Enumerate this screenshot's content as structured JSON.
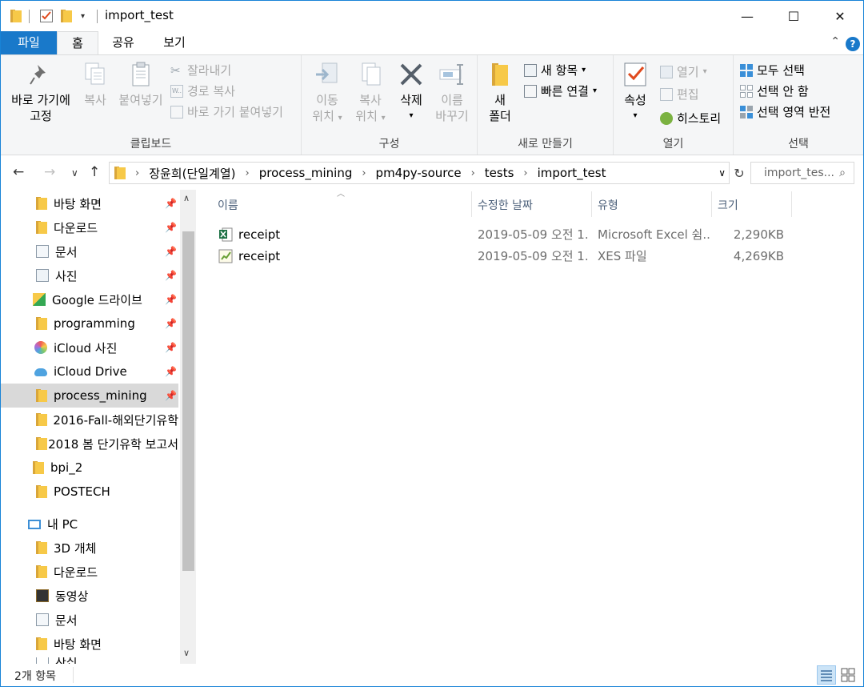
{
  "window": {
    "title": "import_test",
    "minimize": "—",
    "maximize": "☐",
    "close": "✕"
  },
  "ribbon_tabs": [
    "파일",
    "홈",
    "공유",
    "보기"
  ],
  "help_label": "?",
  "clipboard": {
    "pin_label_1": "바로 가기에",
    "pin_label_2": "고정",
    "copy": "복사",
    "paste": "붙여넣기",
    "cut": "잘라내기",
    "copy_path": "경로 복사",
    "paste_shortcut": "바로 가기 붙여넣기",
    "group": "클립보드"
  },
  "organize": {
    "move_1": "이동",
    "move_2": "위치",
    "copy_1": "복사",
    "copy_2": "위치",
    "delete": "삭제",
    "rename_1": "이름",
    "rename_2": "바꾸기",
    "group": "구성"
  },
  "new": {
    "folder_1": "새",
    "folder_2": "폴더",
    "new_item": "새 항목",
    "easy_access": "빠른 연결",
    "group": "새로 만들기"
  },
  "open": {
    "properties": "속성",
    "open": "열기",
    "edit": "편집",
    "history": "히스토리",
    "group": "열기"
  },
  "select": {
    "all": "모두 선택",
    "none": "선택 안 함",
    "invert": "선택 영역 반전",
    "group": "선택"
  },
  "address": {
    "crumbs": [
      "장윤희(단일계열)",
      "process_mining",
      "pm4py-source",
      "tests",
      "import_test"
    ],
    "search_placeholder": "import_tes..."
  },
  "nav_pane": {
    "quick_access": [
      {
        "label": "바탕 화면",
        "pinned": true
      },
      {
        "label": "다운로드",
        "pinned": true
      },
      {
        "label": "문서",
        "pinned": true
      },
      {
        "label": "사진",
        "pinned": true
      },
      {
        "label": "Google 드라이브",
        "pinned": true
      },
      {
        "label": "programming",
        "pinned": true
      },
      {
        "label": "iCloud 사진",
        "pinned": true
      },
      {
        "label": "iCloud Drive",
        "pinned": true
      },
      {
        "label": "process_mining",
        "pinned": true
      },
      {
        "label": "2016-Fall-해외단기유학",
        "pinned": false
      },
      {
        "label": "2018 봄 단기유학 보고서",
        "pinned": false
      },
      {
        "label": "bpi_2",
        "pinned": false
      },
      {
        "label": "POSTECH",
        "pinned": false
      }
    ],
    "this_pc": "내 PC",
    "pc_items": [
      "3D 개체",
      "다운로드",
      "동영상",
      "문서",
      "바탕 화면",
      "사진"
    ]
  },
  "columns": [
    "이름",
    "수정한 날짜",
    "유형",
    "크기"
  ],
  "files": [
    {
      "name": "receipt",
      "modified": "2019-05-09 오전 1...",
      "type": "Microsoft Excel 쉼...",
      "size": "2,290KB"
    },
    {
      "name": "receipt",
      "modified": "2019-05-09 오전 1...",
      "type": "XES 파일",
      "size": "4,269KB"
    }
  ],
  "status": {
    "count": "2개 항목"
  },
  "colors": {
    "accent": "#1979ca",
    "folder": "#f7c948",
    "selection": "#d9d9d9"
  }
}
